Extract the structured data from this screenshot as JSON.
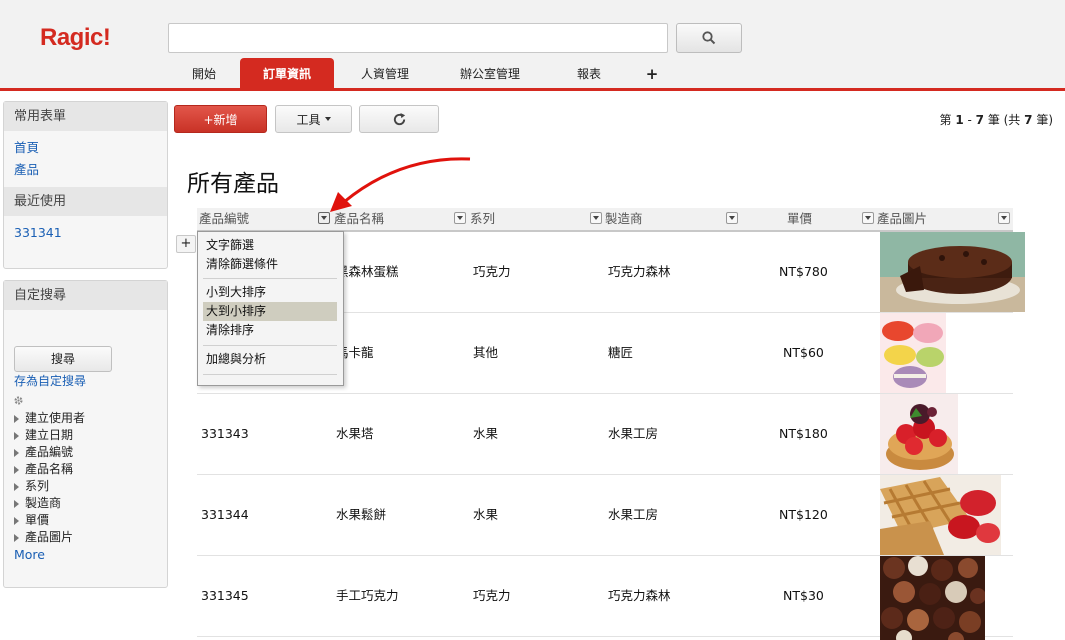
{
  "app": {
    "logo": "Ragic!"
  },
  "search": {
    "placeholder": ""
  },
  "tabs": [
    {
      "label": "開始"
    },
    {
      "label": "訂單資訊"
    },
    {
      "label": "人資管理"
    },
    {
      "label": "辦公室管理"
    },
    {
      "label": "報表"
    },
    {
      "label": "+"
    }
  ],
  "sidebar": {
    "favorites": {
      "title": "常用表單",
      "links": [
        "首頁",
        "產品"
      ]
    },
    "recent": {
      "title": "最近使用",
      "links": [
        "331341"
      ]
    },
    "custom_search": {
      "title": "自定搜尋",
      "search_button": "搜尋",
      "save_link": "存為自定搜尋",
      "fields": [
        "建立使用者",
        "建立日期",
        "產品編號",
        "產品名稱",
        "系列",
        "製造商",
        "單價",
        "產品圖片"
      ],
      "more": "More"
    }
  },
  "toolbar": {
    "add_label": "+新增",
    "tools_label": "工具",
    "pager": {
      "prefix": "第 ",
      "from": "1",
      "dash": " - ",
      "to": "7",
      "mid": " 筆 (共 ",
      "total": "7",
      "suffix": " 筆)"
    }
  },
  "page": {
    "title": "所有產品"
  },
  "table": {
    "columns": [
      "產品編號",
      "產品名稱",
      "系列",
      "製造商",
      "單價",
      "產品圖片"
    ],
    "rows": [
      {
        "id": "",
        "name": "黑森林蛋糕",
        "series": "巧克力",
        "maker": "巧克力森林",
        "price": "NT$780",
        "photo": "chocolate-cake"
      },
      {
        "id": "",
        "name": "馬卡龍",
        "series": "其他",
        "maker": "糖匠",
        "price": "NT$60",
        "photo": "macarons"
      },
      {
        "id": "331343",
        "name": "水果塔",
        "series": "水果",
        "maker": "水果工房",
        "price": "NT$180",
        "photo": "fruit-tart"
      },
      {
        "id": "331344",
        "name": "水果鬆餅",
        "series": "水果",
        "maker": "水果工房",
        "price": "NT$120",
        "photo": "fruit-waffle"
      },
      {
        "id": "331345",
        "name": "手工巧克力",
        "series": "巧克力",
        "maker": "巧克力森林",
        "price": "NT$30",
        "photo": "chocolates"
      }
    ]
  },
  "menu": {
    "items": [
      "文字篩選",
      "清除篩選條件",
      "小到大排序",
      "大到小排序",
      "清除排序",
      "加總與分析"
    ],
    "highlighted": "大到小排序"
  },
  "colors": {
    "accent": "#d42a20",
    "link": "#1a5fb4",
    "menu_highlight": "#cfcdbf"
  }
}
